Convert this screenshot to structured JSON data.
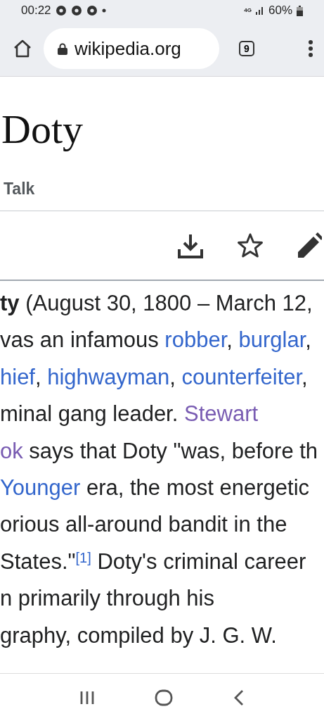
{
  "status_bar": {
    "time": "00:22",
    "network": "4G",
    "battery": "60%"
  },
  "browser": {
    "url": "wikipedia.org",
    "tab_count": "9"
  },
  "article": {
    "title": "Doty",
    "tabs": [
      {
        "label": "Talk",
        "selected": false
      }
    ],
    "lines": [
      [
        {
          "kind": "bold",
          "text": "ty"
        },
        {
          "kind": "plain",
          "text": " (August 30, 1800 – March 12,"
        }
      ],
      [
        {
          "kind": "plain",
          "text": "vas an infamous "
        },
        {
          "kind": "link",
          "text": "robber",
          "after": ", "
        },
        {
          "kind": "link",
          "text": "burglar",
          "after": ","
        }
      ],
      [
        {
          "kind": "link",
          "text": "hief",
          "after": ", "
        },
        {
          "kind": "link",
          "text": "highwayman",
          "after": ", "
        },
        {
          "kind": "link",
          "text": "counterfeiter",
          "after": ","
        }
      ],
      [
        {
          "kind": "plain",
          "text": "minal gang leader. "
        },
        {
          "kind": "visited",
          "text": "Stewart"
        }
      ],
      [
        {
          "kind": "visited",
          "text": "ok"
        },
        {
          "kind": "plain",
          "text": " says that Doty \"was, before th"
        }
      ],
      [
        {
          "kind": "link",
          "text": "Younger"
        },
        {
          "kind": "plain",
          "text": " era, the most energetic"
        }
      ],
      [
        {
          "kind": "plain",
          "text": "orious all-around bandit in the"
        }
      ],
      [
        {
          "kind": "plain",
          "text": "States.\""
        },
        {
          "kind": "ref",
          "text": "[1]"
        },
        {
          "kind": "plain",
          "text": " Doty's criminal career"
        }
      ],
      [
        {
          "kind": "plain",
          "text": "n primarily through his"
        }
      ],
      [
        {
          "kind": "plain",
          "text": "graphy, compiled by J. G. W."
        }
      ]
    ]
  }
}
